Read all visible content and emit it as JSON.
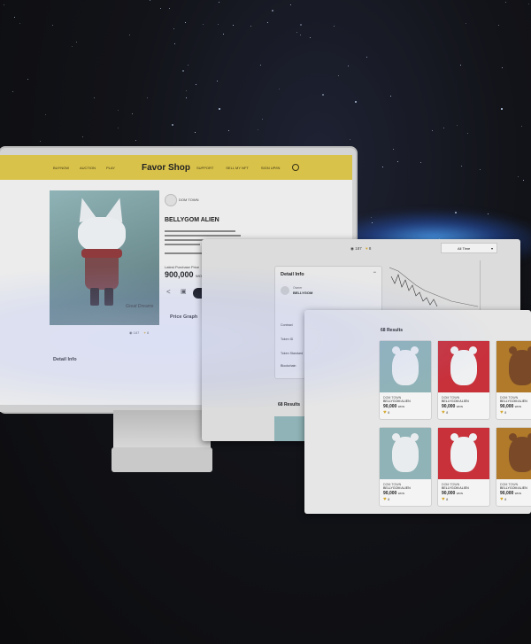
{
  "monitor": {
    "nav": {
      "left_items": [
        "BUYNOW",
        "AUCTION",
        "PLAY"
      ],
      "logo": "Favor Shop",
      "right_items": [
        "SUPPORT",
        "SELL MY NFT",
        "SIGN UP/IN"
      ]
    },
    "owner": "DOM TOWN",
    "title": "BELLYGOM ALIEN",
    "price_label": "Latest Purchase Price",
    "price": "900,000",
    "price_unit": "WON",
    "views": "187",
    "likes": "8",
    "signature": "Great Dreams",
    "section_price_graph": "Price Graph",
    "section_detail": "Detail Info"
  },
  "panel1": {
    "views": "187",
    "likes": "8",
    "detail_title": "Detail Info",
    "owner_label": "Owner",
    "owner_name": "BELLYGOM",
    "chart_filter": "All Time",
    "rows": [
      "Contract",
      "Token ID",
      "Token Standard",
      "Blockchain"
    ],
    "results": "68 Results"
  },
  "panel2": {
    "results": "68 Results",
    "cards": [
      {
        "creator": "DOM TOWN",
        "name": "BELLYGOM ALIEN",
        "price": "90,000",
        "unit": "WON",
        "likes": "8",
        "color": "teal"
      },
      {
        "creator": "DOM TOWN",
        "name": "BELLYGOM ALIEN",
        "price": "90,000",
        "unit": "WON",
        "likes": "8",
        "color": "red"
      },
      {
        "creator": "DOM TOWN",
        "name": "BELLYGOM ALIEN",
        "price": "90,000",
        "unit": "WON",
        "likes": "8",
        "color": "brown"
      },
      {
        "creator": "DOM TOWN",
        "name": "BELLYGOM ALIEN",
        "price": "90,000",
        "unit": "WON",
        "likes": "8",
        "color": "teal"
      },
      {
        "creator": "DOM TOWN",
        "name": "BELLYGOM ALIEN",
        "price": "90,000",
        "unit": "WON",
        "likes": "8",
        "color": "red"
      },
      {
        "creator": "DOM TOWN",
        "name": "BELLYGOM ALIEN",
        "price": "90,000",
        "unit": "WON",
        "likes": "8",
        "color": "brown"
      }
    ]
  },
  "colors": {
    "accent": "#d9c24a",
    "teal": "#8fb3b6",
    "red": "#c8303a",
    "brown": "#b07a2a"
  }
}
